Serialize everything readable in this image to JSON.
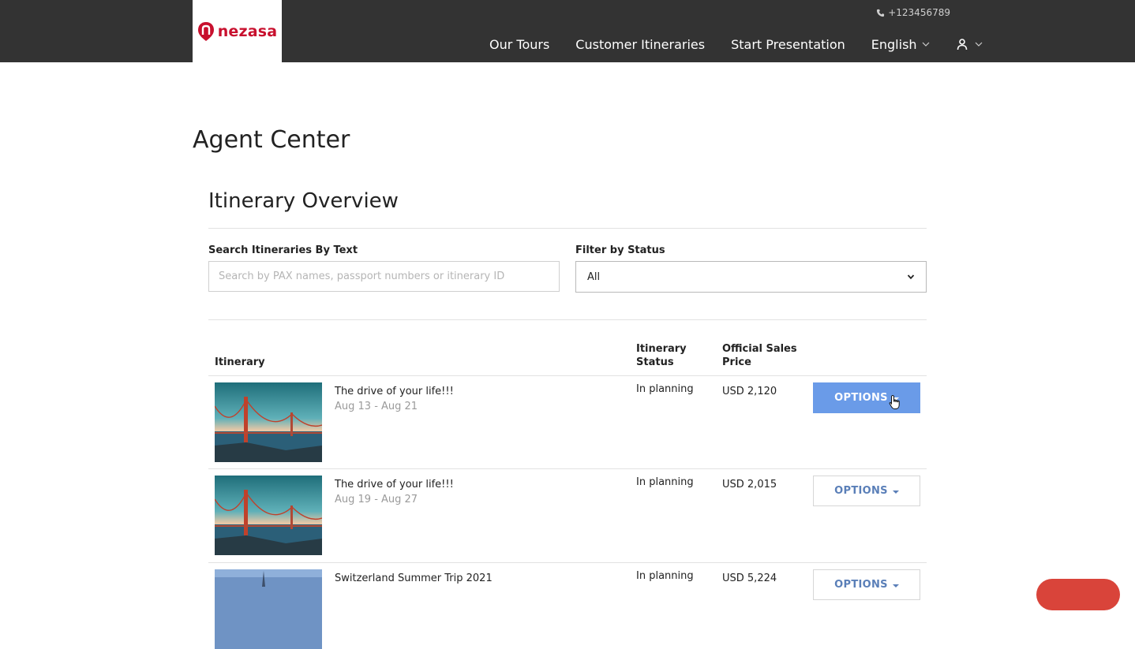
{
  "header": {
    "logo_text": "nezasa",
    "phone": "+123456789",
    "nav": {
      "our_tours": "Our Tours",
      "customer_itineraries": "Customer Itineraries",
      "start_presentation": "Start Presentation",
      "language": "English"
    }
  },
  "page": {
    "title": "Agent Center",
    "section_title": "Itinerary Overview"
  },
  "filters": {
    "search_label": "Search Itineraries By Text",
    "search_placeholder": "Search by PAX names, passport numbers or itinerary ID",
    "search_value": "",
    "status_label": "Filter by Status",
    "status_selected": "All"
  },
  "table": {
    "columns": {
      "itinerary": "Itinerary",
      "status_line1": "Itinerary",
      "status_line2": "Status",
      "price_line1": "Official Sales",
      "price_line2": "Price"
    },
    "rows": [
      {
        "title": "The drive of your life!!!",
        "dates": "Aug 13 - Aug 21",
        "status": "In planning",
        "price": "USD 2,120",
        "options_label": "OPTIONS",
        "thumb": "golden-gate-bridge"
      },
      {
        "title": "The drive of your life!!!",
        "dates": "Aug 19 - Aug 27",
        "status": "In planning",
        "price": "USD 2,015",
        "options_label": "OPTIONS",
        "thumb": "golden-gate-bridge"
      },
      {
        "title": "Switzerland Summer Trip 2021",
        "dates": "",
        "status": "In planning",
        "price": "USD 5,224",
        "options_label": "OPTIONS",
        "thumb": "switzerland-city"
      }
    ]
  },
  "colors": {
    "header_bg": "#333333",
    "brand_red": "#c8102e",
    "options_active": "#6a9be8",
    "options_text": "#5a7fb8"
  }
}
